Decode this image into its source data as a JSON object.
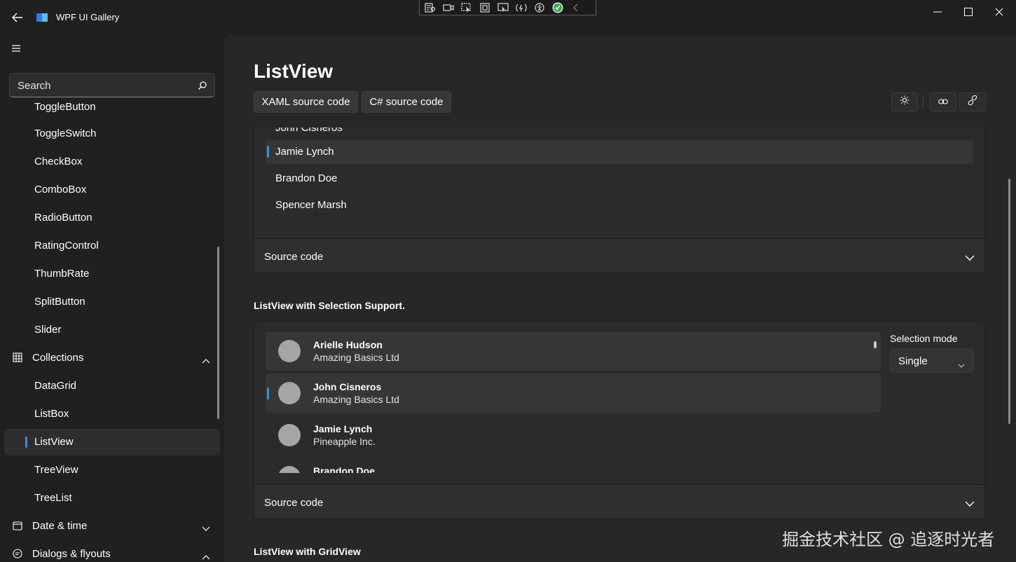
{
  "window": {
    "title": "WPF UI Gallery",
    "accent_color": "#3a8fd6",
    "watermark": "掘金技术社区 @ 追逐时光者"
  },
  "search": {
    "placeholder": "Search"
  },
  "sidebar": {
    "items": [
      {
        "label": "ToggleButton",
        "kind": "sub"
      },
      {
        "label": "ToggleSwitch",
        "kind": "sub"
      },
      {
        "label": "CheckBox",
        "kind": "sub"
      },
      {
        "label": "ComboBox",
        "kind": "sub"
      },
      {
        "label": "RadioButton",
        "kind": "sub"
      },
      {
        "label": "RatingControl",
        "kind": "sub"
      },
      {
        "label": "ThumbRate",
        "kind": "sub"
      },
      {
        "label": "SplitButton",
        "kind": "sub"
      },
      {
        "label": "Slider",
        "kind": "sub"
      },
      {
        "label": "Collections",
        "kind": "group",
        "icon": "grid-icon",
        "expanded": true
      },
      {
        "label": "DataGrid",
        "kind": "sub"
      },
      {
        "label": "ListBox",
        "kind": "sub"
      },
      {
        "label": "ListView",
        "kind": "sub",
        "active": true
      },
      {
        "label": "TreeView",
        "kind": "sub"
      },
      {
        "label": "TreeList",
        "kind": "sub"
      },
      {
        "label": "Date & time",
        "kind": "group",
        "icon": "calendar-icon",
        "expanded": false
      },
      {
        "label": "Dialogs & flyouts",
        "kind": "group",
        "icon": "chat-icon",
        "expanded": true
      }
    ]
  },
  "page": {
    "title": "ListView",
    "buttons": {
      "xaml": "XAML source code",
      "csharp": "C# source code"
    }
  },
  "card1": {
    "items": [
      "John Cisneros",
      "Jamie Lynch",
      "Brandon Doe",
      "Spencer Marsh"
    ],
    "selected": "Jamie Lynch",
    "footer": "Source code"
  },
  "section2": {
    "title": "ListView with Selection Support.",
    "people": [
      {
        "name": "Arielle Hudson",
        "company": "Amazing Basics Ltd"
      },
      {
        "name": "John Cisneros",
        "company": "Amazing Basics Ltd"
      },
      {
        "name": "Jamie Lynch",
        "company": "Pineapple Inc."
      },
      {
        "name": "Brandon Doe",
        "company": ""
      }
    ],
    "selection_mode_label": "Selection mode",
    "selection_mode_value": "Single",
    "footer": "Source code"
  },
  "section3": {
    "title": "ListView with GridView"
  }
}
